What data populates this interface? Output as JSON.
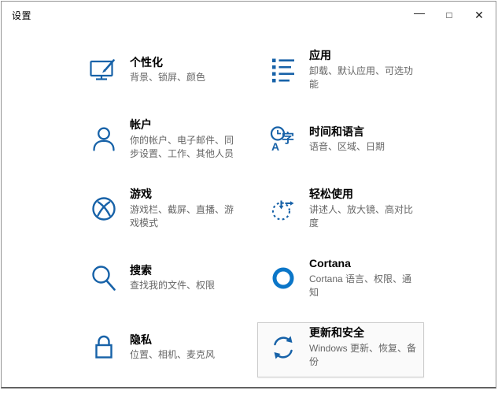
{
  "window": {
    "title": "设置",
    "controls": {
      "minimize": "—",
      "maximize": "□",
      "close": "✕"
    }
  },
  "colors": {
    "icon_accent": "#1762a8",
    "cortana_accent": "#0b76c8",
    "title_text": "#000000",
    "subtitle_text": "#666666",
    "active_tile_bg": "#fafafa",
    "active_tile_border": "#cccccc",
    "window_border": "#939393"
  },
  "tiles": [
    {
      "id": "personalization",
      "icon": "monitor-brush-icon",
      "title": "个性化",
      "subtitle": "背景、锁屏、颜色",
      "highlighted": false
    },
    {
      "id": "apps",
      "icon": "apps-list-icon",
      "title": "应用",
      "subtitle": "卸载、默认应用、可选功能",
      "highlighted": false
    },
    {
      "id": "accounts",
      "icon": "person-icon",
      "title": "帐户",
      "subtitle": "你的帐户、电子邮件、同步设置、工作、其他人员",
      "highlighted": false
    },
    {
      "id": "time-language",
      "icon": "clock-language-icon",
      "title": "时间和语言",
      "subtitle": "语音、区域、日期",
      "highlighted": false
    },
    {
      "id": "gaming",
      "icon": "xbox-icon",
      "title": "游戏",
      "subtitle": "游戏栏、截屏、直播、游戏模式",
      "highlighted": false
    },
    {
      "id": "ease-of-access",
      "icon": "ease-of-access-icon",
      "title": "轻松使用",
      "subtitle": "讲述人、放大镜、高对比度",
      "highlighted": false
    },
    {
      "id": "search",
      "icon": "search-icon",
      "title": "搜索",
      "subtitle": "查找我的文件、权限",
      "highlighted": false
    },
    {
      "id": "cortana",
      "icon": "cortana-icon",
      "title": "Cortana",
      "subtitle": "Cortana 语言、权限、通知",
      "highlighted": false
    },
    {
      "id": "privacy",
      "icon": "lock-icon",
      "title": "隐私",
      "subtitle": "位置、相机、麦克风",
      "highlighted": false
    },
    {
      "id": "update-security",
      "icon": "sync-icon",
      "title": "更新和安全",
      "subtitle": "Windows 更新、恢复、备份",
      "highlighted": true
    }
  ]
}
